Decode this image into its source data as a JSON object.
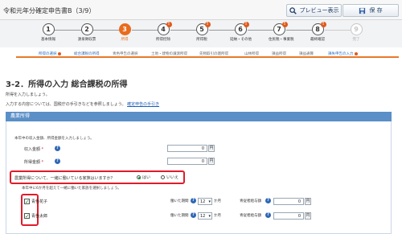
{
  "app": {
    "title": "令和元年分確定申告書B（3/9）"
  },
  "toolbar": {
    "preview_label": "プレビュー表示",
    "save_label": "保 存"
  },
  "steps": [
    {
      "num": "1",
      "label": "基本情報",
      "state": "done"
    },
    {
      "num": "2",
      "label": "源泉徴収票",
      "state": "done"
    },
    {
      "num": "3",
      "label": "所得",
      "state": "current"
    },
    {
      "num": "4",
      "label": "所得控除",
      "state": "alert"
    },
    {
      "num": "5",
      "label": "所得税",
      "state": "alert"
    },
    {
      "num": "6",
      "label": "延納・その他",
      "state": "alert"
    },
    {
      "num": "7",
      "label": "住民税・事業税",
      "state": "alert"
    },
    {
      "num": "8",
      "label": "最終確認",
      "state": "alert"
    },
    {
      "num": "9",
      "label": "完了",
      "state": "disabled"
    }
  ],
  "subnav": [
    {
      "label": "所得の選択",
      "state": "alert"
    },
    {
      "label": "総合課税の所得",
      "state": "active"
    },
    {
      "label": "青色申告の選択",
      "state": "normal"
    },
    {
      "label": "土地・建物の譲渡所得",
      "state": "normal"
    },
    {
      "label": "先物取引の雑所得",
      "state": "normal"
    },
    {
      "label": "山林所得",
      "state": "normal"
    },
    {
      "label": "損益所得",
      "state": "normal"
    },
    {
      "label": "損益通算",
      "state": "normal"
    },
    {
      "label": "損失申告の入力",
      "state": "alert"
    }
  ],
  "page": {
    "title": "3-2．所得の入力 総合課税の所得",
    "intro1": "所得を入力しましょう。",
    "intro2": "入力する内容については、国税庁の手引きなどを参照しましょう。",
    "intro2_link": "確定申告の手引き"
  },
  "section": {
    "header": "農業所得",
    "note1": "本年中の収入金額、所得金額を入力しましょう。",
    "revenue_label": "収入金額",
    "revenue_value": "0",
    "income_label": "所得金額",
    "income_value": "0",
    "unit": "円",
    "question": "農業所得について、一緒に働いている家族はいますか？",
    "yes_label": "はい",
    "no_label": "いいえ",
    "note2": "本年中に6か月を超えて一緒に働いた家族を選択しましょう。",
    "period_label": "働いた期間",
    "period_value": "12",
    "months_unit": "か月",
    "deduction_label": "青従者給与額",
    "family": [
      {
        "name": "青色花子",
        "checked": true,
        "amount": "0"
      },
      {
        "name": "青色太郎",
        "checked": true,
        "amount": "0"
      }
    ]
  },
  "colors": {
    "accent": "#e86b1e",
    "section_blue": "#5a8fc7",
    "highlight": "#e01c2b"
  }
}
